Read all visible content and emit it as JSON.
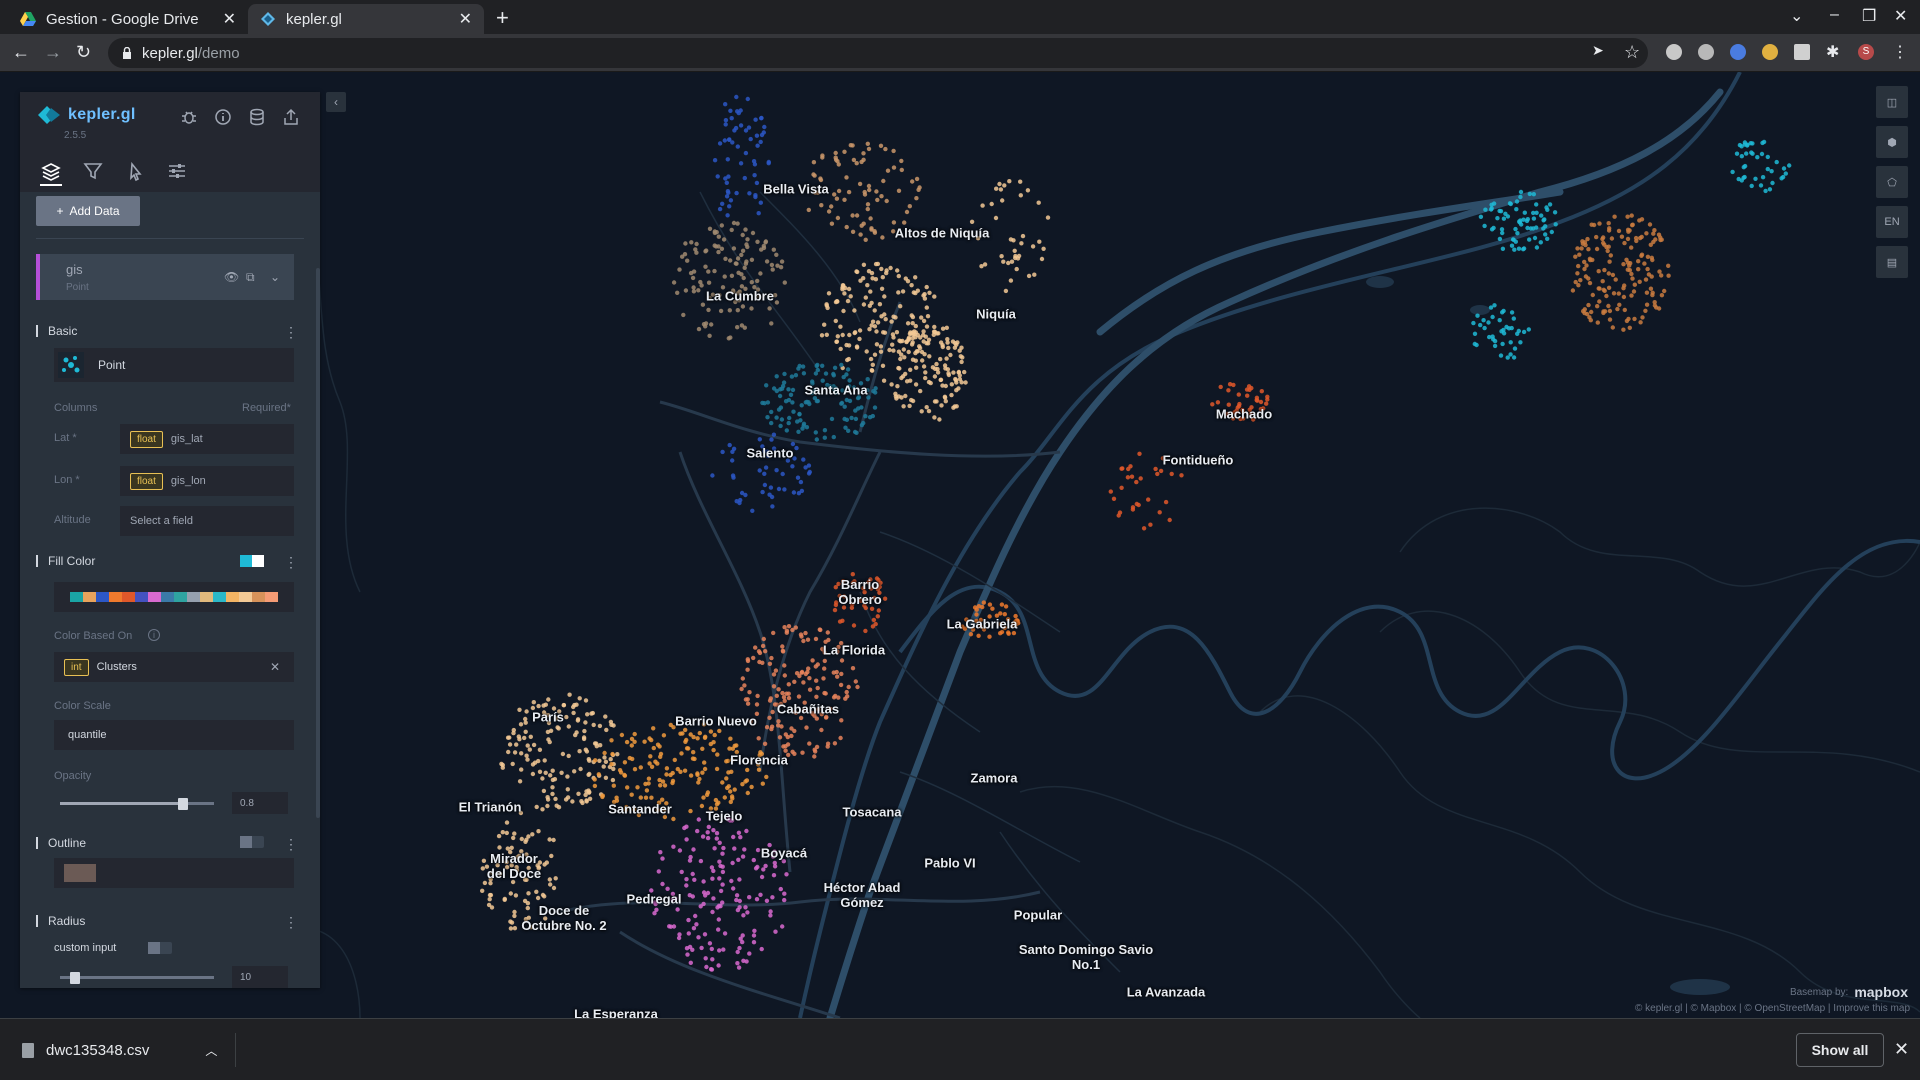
{
  "browser": {
    "tabs": [
      {
        "title": "Gestion - Google Drive",
        "icon": "google-drive-icon",
        "active": false
      },
      {
        "title": "kepler.gl",
        "icon": "kepler-icon",
        "active": true
      }
    ],
    "url_host": "kepler.gl",
    "url_path": "/demo"
  },
  "app": {
    "name": "kepler.gl",
    "version": "2.5.5",
    "add_data_label": "Add Data"
  },
  "layer": {
    "name": "gis",
    "type": "Point",
    "basic_label": "Basic",
    "layer_type_label": "Point",
    "columns_label": "Columns",
    "required_label": "Required*",
    "lat_label": "Lat *",
    "lat_type": "float",
    "lat_field": "gis_lat",
    "lon_label": "Lon *",
    "lon_type": "float",
    "lon_field": "gis_lon",
    "altitude_label": "Altitude",
    "altitude_placeholder": "Select a field",
    "fill_color_label": "Fill Color",
    "palette": [
      "#1aa5a5",
      "#e8a35c",
      "#2c57c6",
      "#f07a2d",
      "#e0582a",
      "#4452c0",
      "#d96ad0",
      "#3b7aa8",
      "#2fa3a0",
      "#96a0ae",
      "#e1b97d",
      "#2bb8c8",
      "#f3b464",
      "#f3c995",
      "#d7925a",
      "#f59b75"
    ],
    "color_based_on_label": "Color Based On",
    "color_field_type": "int",
    "color_field": "Clusters",
    "color_scale_label": "Color Scale",
    "color_scale": "quantile",
    "opacity_label": "Opacity",
    "opacity": "0.8",
    "outline_label": "Outline",
    "outline_color": "#6b5a55",
    "radius_label": "Radius",
    "custom_input_label": "custom input",
    "radius": "10"
  },
  "map": {
    "places": [
      "Bella Vista",
      "Altos de Niquía",
      "La Cumbre",
      "Niquía",
      "Santa Ana",
      "Salento",
      "Machado",
      "Fontidueño",
      "Barrio Obrero",
      "La Gabriela",
      "La Florida",
      "Cabañitas",
      "París",
      "Barrio Nuevo",
      "Florencia",
      "Zamora",
      "El Trianón",
      "Santander",
      "Tejelo",
      "Tosacana",
      "Mirador del Doce",
      "Boyacá",
      "Héctor Abad Gómez",
      "Pablo VI",
      "Doce de Octubre No. 2",
      "Pedregal",
      "Popular",
      "Santo Domingo Savio No.1",
      "La Avanzada",
      "La Esperanza"
    ],
    "tools": [
      "split-map-icon",
      "3d-map-icon",
      "draw-polygon-icon",
      "EN",
      "legend-icon"
    ],
    "basemap_label": "Basemap by:",
    "basemap_brand": "mapbox",
    "attribution": "© kepler.gl | © Mapbox | © OpenStreetMap | Improve this map"
  },
  "downloads": {
    "file": "dwc135348.csv",
    "show_all": "Show all"
  }
}
